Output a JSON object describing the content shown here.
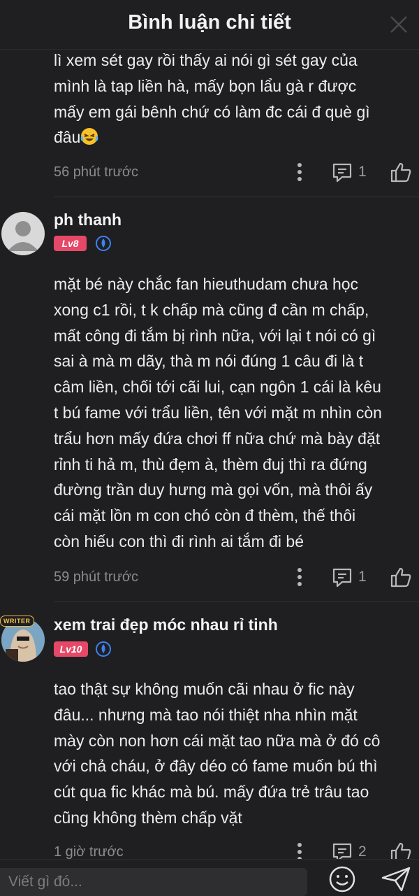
{
  "header": {
    "title": "Bình luận chi tiết"
  },
  "comments": [
    {
      "text": "lì xem sét gay rồi thấy ai nói gì sét gay của\nmình là tap liền hà, mấy bọn lẩu gà r được\nmấy em gái bênh chứ có làm đc cái đ què gì\nđâu",
      "emoji": "laughing-emoji",
      "time": "56 phút trước",
      "replies": "1"
    },
    {
      "author": "ph thanh",
      "level": "Lv8",
      "text": "mặt bé này chắc fan hieuthudam chưa học\nxong c1 rồi, t k chấp mà cũng đ cần m chấp,\nmất công đi tắm bị rình nữa, với lại t nói có gì\nsai à mà m dãy, thà m nói đúng 1 câu đi là t\ncâm liền, chối tới cãi lui, cạn ngôn 1 cái là kêu\nt bú fame với trẩu liền, tên với mặt m nhìn còn\ntrẩu hơn mấy đứa chơi ff nữa chứ mà bày đặt\nrỉnh ti hả m, thù đẹm à, thèm đuj thì ra đứng\nđường trần duy hưng mà gọi vốn, mà thôi ấy\ncái mặt lồn m con chó còn đ thèm, thế thôi\ncòn hiếu con thì đi rình ai tắm đi bé",
      "time": "59 phút trước",
      "replies": "1"
    },
    {
      "author": "xem trai đẹp móc nhau rỉ tinh",
      "level": "Lv10",
      "avatar_badge": "WRITER",
      "text": "tao thật sự không muốn cãi nhau ở fic này\nđâu... nhưng mà tao nói thiệt nha nhìn mặt\nmày còn non hơn cái mặt tao nữa mà ở đó cô\nvới chả cháu, ở đây déo có fame muốn bú thì\ncút qua fic khác mà bú. mấy đứa trẻ trâu tao\ncũng không thèm chấp vặt",
      "time": "1 giờ trước",
      "replies": "2"
    }
  ],
  "input": {
    "placeholder": "Viết gì đó..."
  },
  "colors": {
    "background": "#1f1f21",
    "badge": "#e64868",
    "verify": "#3b82f6"
  }
}
